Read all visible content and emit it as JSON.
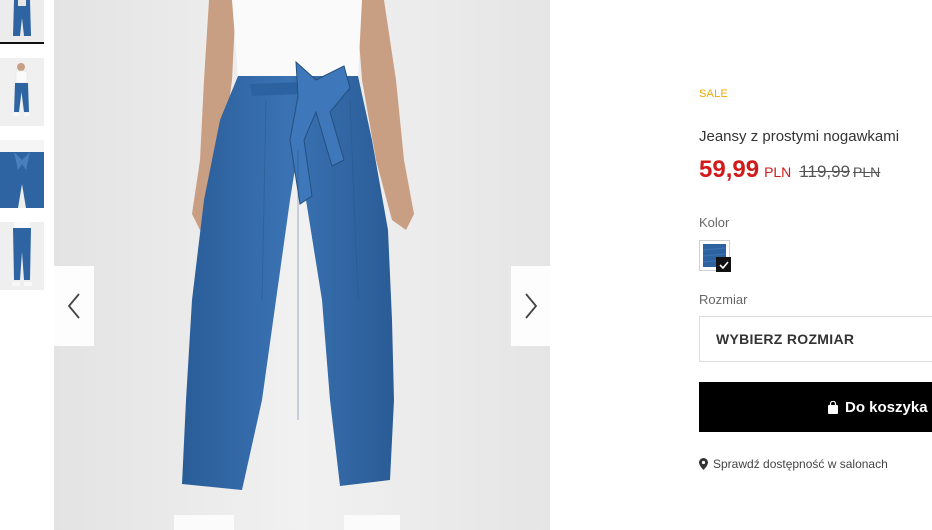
{
  "gallery": {
    "thumbnails": [
      {
        "name": "thumbnail-front-top",
        "active": true
      },
      {
        "name": "thumbnail-full-body"
      },
      {
        "name": "thumbnail-waist-detail"
      },
      {
        "name": "thumbnail-back-view"
      }
    ],
    "prev_icon": "chevron-left-icon",
    "next_icon": "chevron-right-icon"
  },
  "product": {
    "badge": "SALE",
    "name": "Jeansy z prostymi nogawkami",
    "price": {
      "current": "59,99",
      "current_currency": "PLN",
      "old": "119,99",
      "old_currency": "PLN"
    },
    "color": {
      "label": "Kolor",
      "selected": "denim-blue",
      "swatch_color": "#2d62a0"
    },
    "size": {
      "label": "Rozmiar",
      "placeholder": "WYBIERZ ROZMIAR"
    },
    "add_to_cart": "Do koszyka",
    "store_availability": "Sprawdź dostępność w salonach"
  },
  "colors": {
    "sale": "#f2a900",
    "price": "#d11a1a",
    "button": "#000000",
    "denim": "#2d62a0"
  }
}
